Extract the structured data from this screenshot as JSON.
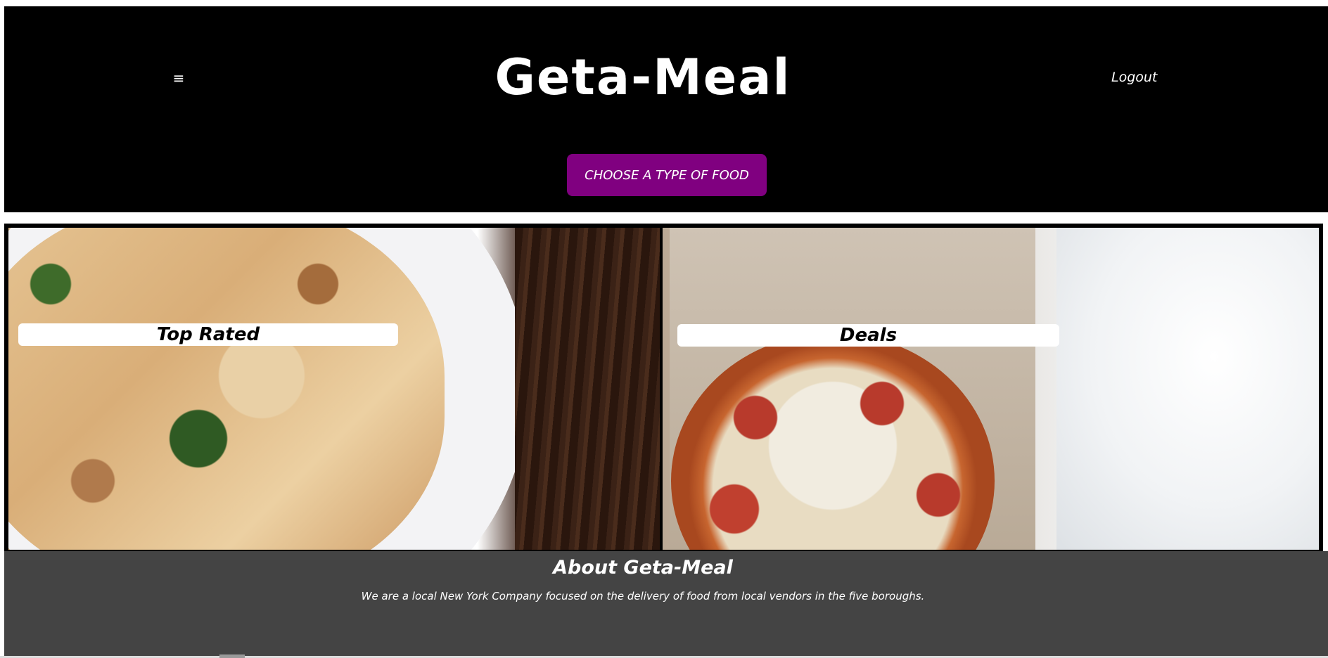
{
  "header": {
    "menu_icon": "hamburger-icon",
    "menu_glyph": "≡",
    "brand": "Geta-Meal",
    "logout_label": "Logout",
    "choose_button_label": "CHOOSE A TYPE OF FOOD"
  },
  "cards": [
    {
      "label": "Top Rated",
      "image": "pasta-dish-photo"
    },
    {
      "label": "Deals",
      "image": "pizza-in-box-photo"
    }
  ],
  "about": {
    "title": "About Geta-Meal",
    "text": "We are a local New York Company focused on the delivery of food from local vendors in the five boroughs."
  },
  "colors": {
    "header_bg": "#000000",
    "button_bg": "#800080",
    "about_bg": "#444444"
  }
}
